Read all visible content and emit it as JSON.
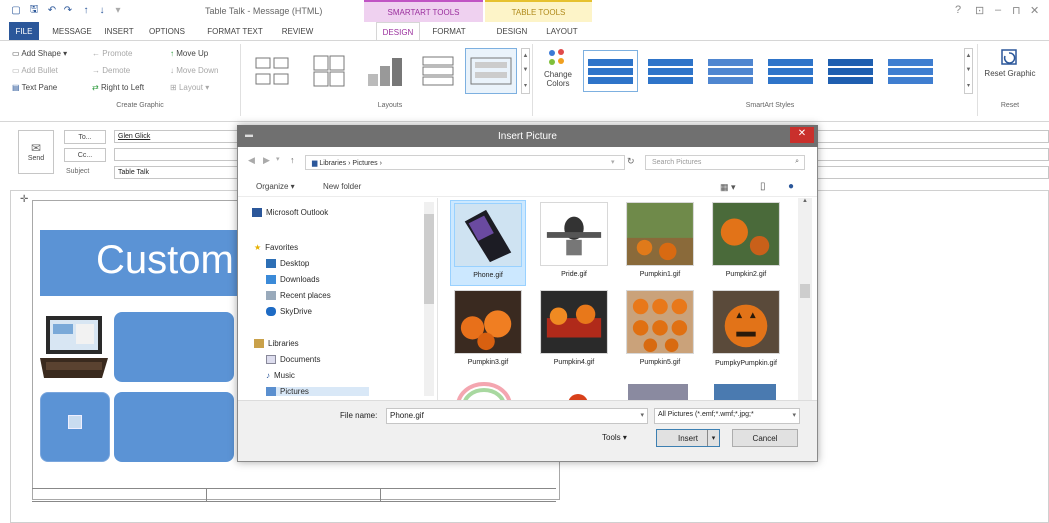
{
  "window": {
    "title": "Table Talk - Message (HTML)",
    "ctx_smartart": "SMARTART TOOLS",
    "ctx_table": "TABLE TOOLS",
    "controls": [
      "?",
      "⊡",
      "–",
      "⊓",
      "✕"
    ]
  },
  "tabs": [
    "FILE",
    "MESSAGE",
    "INSERT",
    "OPTIONS",
    "FORMAT TEXT",
    "REVIEW",
    "DESIGN",
    "FORMAT",
    "DESIGN",
    "LAYOUT"
  ],
  "ribbon": {
    "create_graphic": {
      "add_shape": "Add Shape",
      "add_bullet": "Add Bullet",
      "text_pane": "Text Pane",
      "promote": "Promote",
      "demote": "Demote",
      "right_to_left": "Right to Left",
      "move_up": "Move Up",
      "move_down": "Move Down",
      "layout": "Layout",
      "label": "Create Graphic"
    },
    "layouts_label": "Layouts",
    "change_colors": "Change Colors",
    "smartart_styles_label": "SmartArt Styles",
    "reset_graphic": "Reset Graphic",
    "reset_label": "Reset"
  },
  "compose": {
    "send": "Send",
    "to_button": "To...",
    "cc_button": "Cc...",
    "subject_label": "Subject",
    "to_value": "Glen Glick",
    "subject_value": "Table Talk"
  },
  "document": {
    "smartart_title": "Custom"
  },
  "dialog": {
    "title": "Insert Picture",
    "breadcrumb": "Libraries  ›  Pictures  ›",
    "search_placeholder": "Search Pictures",
    "organize": "Organize ▾",
    "new_folder": "New folder",
    "nav": {
      "outlook": "Microsoft Outlook",
      "favorites": "Favorites",
      "desktop": "Desktop",
      "downloads": "Downloads",
      "recent": "Recent places",
      "skydrive": "SkyDrive",
      "libraries": "Libraries",
      "documents": "Documents",
      "music": "Music",
      "pictures": "Pictures"
    },
    "files": [
      "Phone.gif",
      "Pride.gif",
      "Pumpkin1.gif",
      "Pumpkin2.gif",
      "Pumpkin3.gif",
      "Pumpkin4.gif",
      "Pumpkin5.gif",
      "PumpkyPumpkin.gif"
    ],
    "file_name_label": "File name:",
    "file_name_value": "Phone.gif",
    "filter": "All Pictures (*.emf;*.wmf;*.jpg;*",
    "tools": "Tools",
    "insert": "Insert",
    "cancel": "Cancel"
  },
  "colors": {
    "file_tab": "#2b579a",
    "smartart_tint": "#efd1f0",
    "table_tint": "#fdf4c8",
    "shape_blue": "#5b93d5",
    "close_red": "#c9302c"
  }
}
